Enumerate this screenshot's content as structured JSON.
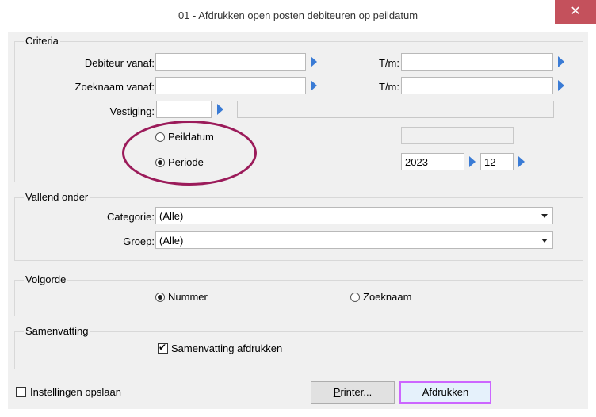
{
  "window": {
    "title": "01 - Afdrukken open posten debiteuren op peildatum",
    "close_glyph": "✕"
  },
  "criteria": {
    "legend": "Criteria",
    "debiteur_vanaf_label": "Debiteur vanaf:",
    "debiteur_vanaf_value": "",
    "debiteur_tm_label": "T/m:",
    "debiteur_tm_value": "",
    "zoeknaam_vanaf_label": "Zoeknaam vanaf:",
    "zoeknaam_vanaf_value": "",
    "zoeknaam_tm_label": "T/m:",
    "zoeknaam_tm_value": "",
    "vestiging_label": "Vestiging:",
    "vestiging_value": "",
    "vestiging_name_value": "",
    "peildatum_label": "Peildatum",
    "peildatum_selected": false,
    "peildatum_value": "",
    "periode_label": "Periode",
    "periode_selected": true,
    "periode_year": "2023",
    "periode_month": "12"
  },
  "vallend_onder": {
    "legend": "Vallend onder",
    "categorie_label": "Categorie:",
    "categorie_value": "(Alle)",
    "groep_label": "Groep:",
    "groep_value": "(Alle)"
  },
  "volgorde": {
    "legend": "Volgorde",
    "nummer_label": "Nummer",
    "nummer_selected": true,
    "zoeknaam_label": "Zoeknaam",
    "zoeknaam_selected": false
  },
  "samenvatting": {
    "legend": "Samenvatting",
    "afdrukken_label": "Samenvatting afdrukken",
    "afdrukken_checked": true
  },
  "footer": {
    "instellingen_label": "Instellingen opslaan",
    "instellingen_checked": false,
    "printer_label_prefix": "P",
    "printer_label_rest": "rinter...",
    "afdrukken_label": "Afdrukken"
  },
  "colors": {
    "arrow": "#3a7bd5",
    "close_button": "#c4515c",
    "highlight_ellipse": "#9b1b5a",
    "default_button_border": "#cc66ff"
  }
}
